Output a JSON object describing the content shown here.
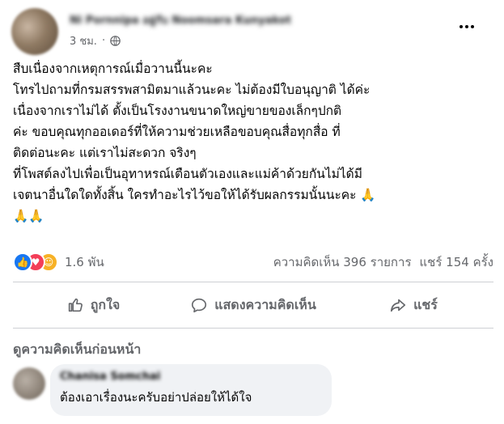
{
  "post": {
    "author": "Ni Pornnipa อยู่กับ Noomsara Kunyakot",
    "time": "3 ชม.",
    "privacy_icon": "globe-icon",
    "body_lines": [
      "สืบเนื่องจากเหตุการณ์เมื่อวานนี้นะคะ",
      "โทรไปถามที่กรมสรรพสามิต￼มาแล้วนะคะ ไม่ต้องมีใบอนุญาติ ได้ค่ะ",
      "เนื่องจากเราไม่ได้ ตั้งเป็นโรงงานขนาดใหญ่ขายของเล็กๆปกติ￼￼",
      "ค่ะ ขอบคุณทุกออเดอร์ที่ให้ความช่วยเหลือขอบคุณสื่อทุก￼สื่อ ที่",
      "ติดต่อนะคะ แต่เราไม่สะดวก จริงๆ",
      "ที่โพสต์ลงไปเพื่อเป็นอุทาหรณ์เตือนตัวเองและแม่ค้าด้วยกันไม่ได้มี",
      "เจตนาอื่นใดใดทั้งสิ้น ใครทำอะไรไว้ขอให้ได้รับผลกรรมนั้นนะคะ 🙏",
      "🙏🙏"
    ]
  },
  "stats": {
    "reactions": "1.6 พัน",
    "comments": "ความคิดเห็น 396 รายการ",
    "shares": "แชร์ 154 ครั้ง"
  },
  "actions": {
    "like": "ถูกใจ",
    "comment": "แสดงความคิดเห็น",
    "share": "แชร์"
  },
  "comments_link": "ดูความคิดเห็นก่อนหน้า",
  "comment": {
    "author": "Chanisa Somchai",
    "text": "ต้องเอาเรื่องนะครับอย่าปล่อยให้ได้ใจ"
  },
  "colors": {
    "brand_blue": "#1877f2",
    "secondary_text": "#65676b",
    "comment_bubble": "#f0f2f5"
  }
}
